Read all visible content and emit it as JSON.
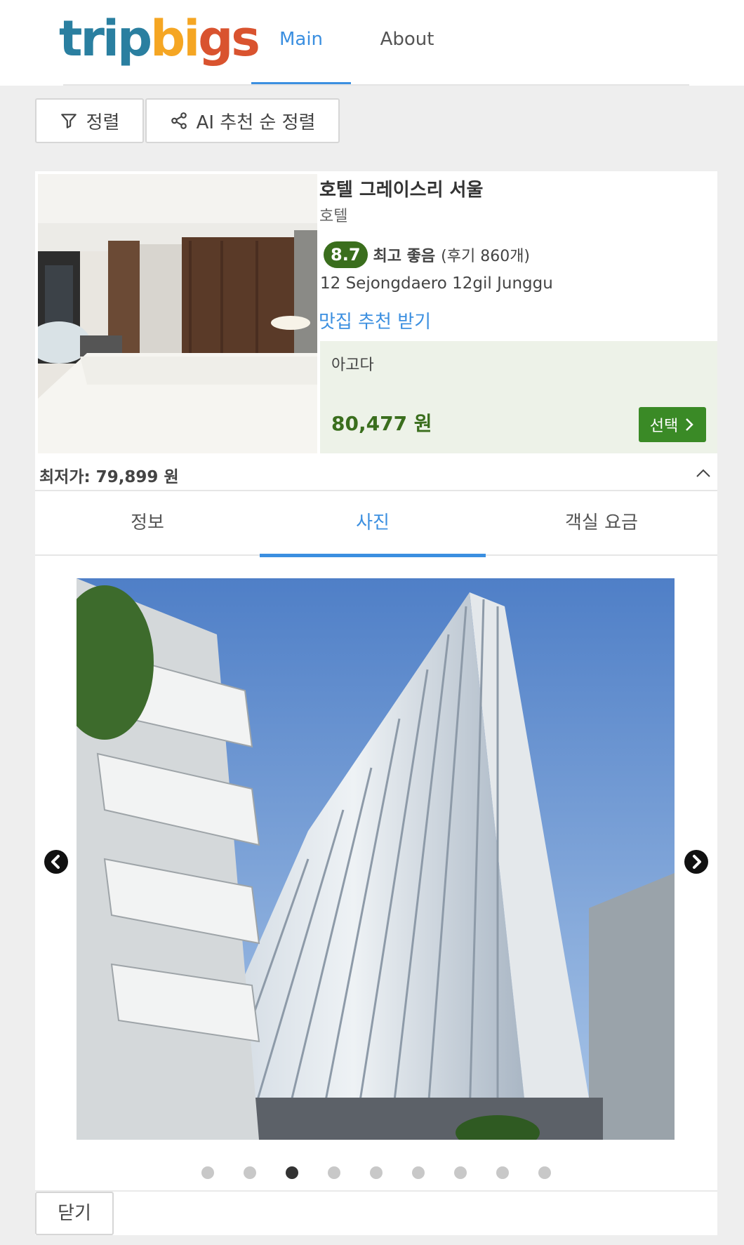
{
  "header": {
    "logo_part1": "trip",
    "logo_part2": "bi",
    "logo_part3": "gs",
    "nav": [
      {
        "label": "Main",
        "active": true
      },
      {
        "label": "About",
        "active": false
      }
    ]
  },
  "toolbar": {
    "sort_label": "정렬",
    "ai_sort_label": "AI 추천 순 정렬"
  },
  "hotel": {
    "name": "호텔 그레이스리 서울",
    "type": "호텔",
    "score": "8.7",
    "rating_label": "최고 좋음",
    "review_count": "(후기 860개)",
    "address": "12 Sejongdaero 12gil Junggu",
    "food_link": "맛집 추천 받기",
    "offer": {
      "provider": "아고다",
      "price": "80,477 원",
      "select_label": "선택"
    },
    "min_price": "최저가: 79,899 원"
  },
  "detail_tabs": [
    {
      "label": "정보",
      "active": false
    },
    {
      "label": "사진",
      "active": true
    },
    {
      "label": "객실 요금",
      "active": false
    }
  ],
  "gallery": {
    "total_slides": 9,
    "active_index": 2
  },
  "close_label": "닫기",
  "colors": {
    "accent_blue": "#3b8fe0",
    "score_green": "#3a6e1d",
    "select_green": "#3a8a26",
    "offer_bg": "#edf2e8"
  },
  "icons": [
    "filter-icon",
    "share-icon",
    "chevron-right-icon",
    "chevron-up-icon",
    "arrow-left-circle-icon",
    "arrow-right-circle-icon"
  ]
}
